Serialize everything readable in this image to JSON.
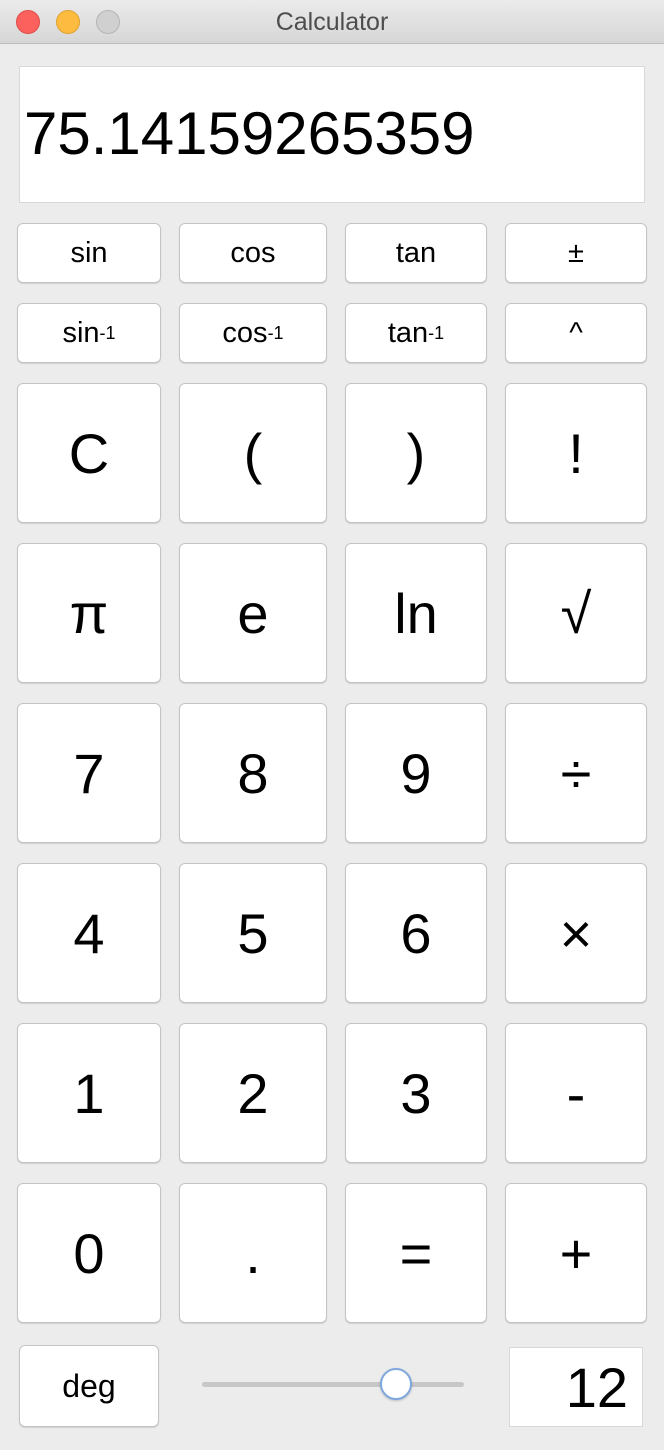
{
  "window": {
    "title": "Calculator"
  },
  "display": {
    "value": "75.14159265359"
  },
  "keypad": {
    "row1": {
      "sin": "sin",
      "cos": "cos",
      "tan": "tan",
      "plus_minus": "±"
    },
    "row2": {
      "asin": "sin",
      "acos": "cos",
      "atan": "tan",
      "inverse_sup": "-1",
      "power": "^"
    },
    "row3": {
      "clear": "C",
      "open_paren": "(",
      "close_paren": ")",
      "factorial": "!"
    },
    "row4": {
      "pi": "π",
      "e": "e",
      "ln": "ln",
      "sqrt": "√"
    },
    "row5": {
      "seven": "7",
      "eight": "8",
      "nine": "9",
      "divide": "÷"
    },
    "row6": {
      "four": "4",
      "five": "5",
      "six": "6",
      "multiply": "×"
    },
    "row7": {
      "one": "1",
      "two": "2",
      "three": "3",
      "minus": "-"
    },
    "row8": {
      "zero": "0",
      "decimal": ".",
      "equals": "=",
      "plus": "+"
    }
  },
  "footer": {
    "angle_mode": "deg",
    "precision_slider_fraction": 0.74,
    "precision_value": "12"
  }
}
